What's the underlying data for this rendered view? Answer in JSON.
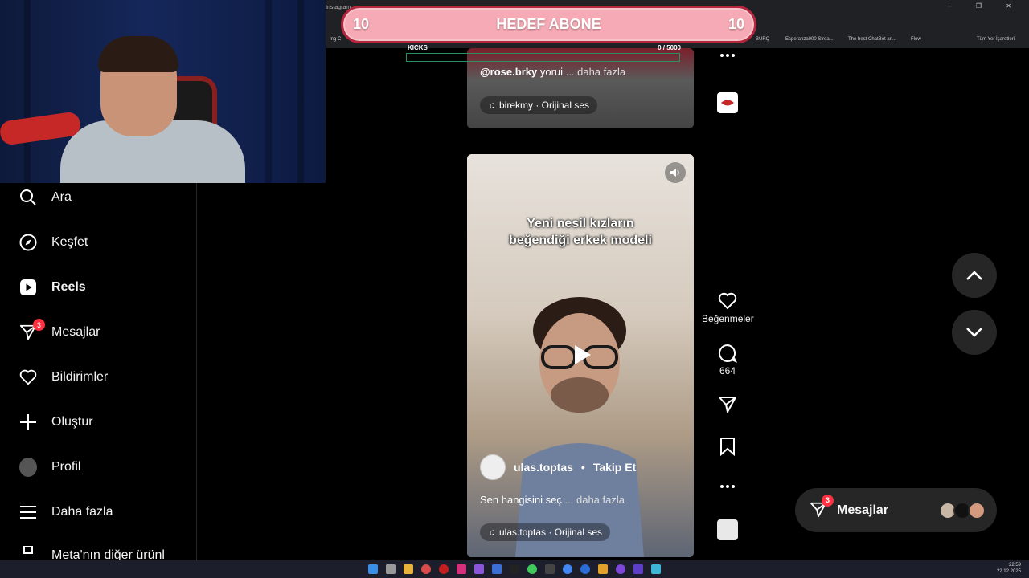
{
  "browser": {
    "tab_title": "Instagram",
    "window_controls": "– ❐ ✕",
    "bookmarks": [
      "İng C",
      "BURÇ",
      "Esperanza000 Strea...",
      "The best ChatBot an...",
      "Flow",
      "Tüm Yer İşaretleri"
    ]
  },
  "stream_overlay": {
    "goal_left": "10",
    "goal_title": "HEDEF ABONE",
    "goal_right": "10",
    "kicks_label": "KICKS",
    "kicks_progress": "0 / 5000",
    "kicks_fraction": 0
  },
  "sidebar": {
    "items": [
      {
        "label": "Ara",
        "icon": "search-icon"
      },
      {
        "label": "Keşfet",
        "icon": "compass-icon"
      },
      {
        "label": "Reels",
        "icon": "reels-icon"
      },
      {
        "label": "Mesajlar",
        "icon": "messenger-icon",
        "badge": "3"
      },
      {
        "label": "Bildirimler",
        "icon": "heart-icon"
      },
      {
        "label": "Oluştur",
        "icon": "plus-icon"
      },
      {
        "label": "Profil",
        "icon": "avatar"
      },
      {
        "label": "Daha fazla",
        "icon": "menu-icon"
      },
      {
        "label": "Meta'nın diğer ürünl",
        "icon": "meta-icon"
      }
    ]
  },
  "reel1": {
    "comment_user": "@rose.brky",
    "comment_text": "yorui",
    "more": "... daha fazla",
    "audio": "birekmy · Orijinal ses"
  },
  "reel2": {
    "caption_line1": "Yeni nesil kızların",
    "caption_line2": "beğendiği erkek modeli",
    "username": "ulas.toptas",
    "follow": "Takip Et",
    "description": "Sen hangisini seç",
    "more": "... daha fazla",
    "audio": "ulas.toptas · Orijinal ses"
  },
  "actions": {
    "like_label": "Beğenmeler",
    "comments_count": "664"
  },
  "messages_dock": {
    "label": "Mesajlar",
    "badge": "3"
  },
  "system": {
    "time": "22:59",
    "date": "22.12.2025"
  },
  "colors": {
    "goal_fill": "#f6aab5",
    "goal_border": "#b3263d",
    "badge": "#ff3040",
    "kicks_track": "#2d8f5f"
  }
}
